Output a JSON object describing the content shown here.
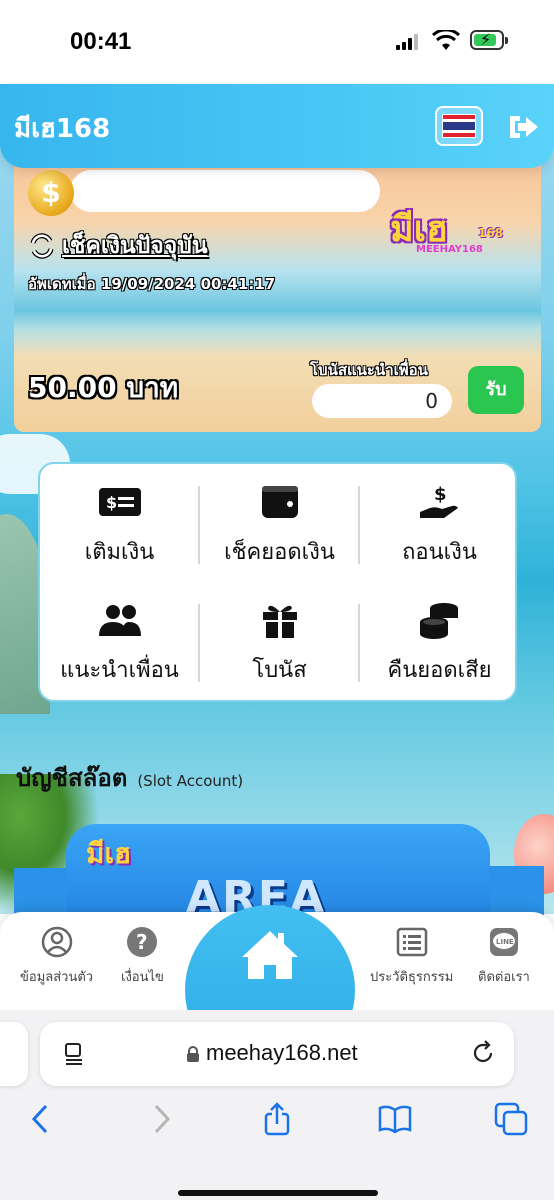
{
  "status_bar": {
    "time": "00:41"
  },
  "header": {
    "brand": "มีเฮ168"
  },
  "balance": {
    "check_label": "เช็คเงินปัจจุบัน",
    "updated_text": "อัพเดทเมื่อ 19/09/2024 00:41:17",
    "amount_text": "50.00 บาท",
    "referral_label": "โบนัสแนะนำเพื่อน",
    "referral_value": "0",
    "claim_label": "รับ",
    "logo_main": "มีเฮ",
    "logo_num": "168",
    "logo_sub": "MEEHAY168"
  },
  "menu": {
    "items": [
      {
        "label": "เติมเงิน",
        "icon": "money-bill-icon"
      },
      {
        "label": "เช็คยอดเงิน",
        "icon": "wallet-icon"
      },
      {
        "label": "ถอนเงิน",
        "icon": "hand-dollar-icon"
      },
      {
        "label": "แนะนำเพื่อน",
        "icon": "users-icon"
      },
      {
        "label": "โบนัส",
        "icon": "gift-icon"
      },
      {
        "label": "คืนยอดเสีย",
        "icon": "coins-icon"
      }
    ]
  },
  "section": {
    "title_th": "บัญชีสล๊อต",
    "title_en": "(Slot Account)"
  },
  "slot": {
    "banner_text": "AREA"
  },
  "bottom_nav": {
    "items": [
      {
        "label": "ข้อมูลส่วนตัว",
        "icon": "user-circle-icon"
      },
      {
        "label": "เงื่อนไข",
        "icon": "question-circle-icon"
      },
      {
        "label": "ประวัติธุรกรรม",
        "icon": "list-icon"
      },
      {
        "label": "ติดต่อเรา",
        "icon": "line-icon"
      }
    ],
    "home_icon": "home-icon"
  },
  "browser": {
    "url": "meehay168.net"
  },
  "colors": {
    "header": "#3ab8ee",
    "claim": "#2bc650",
    "menu_border": "#7fd3ea"
  }
}
